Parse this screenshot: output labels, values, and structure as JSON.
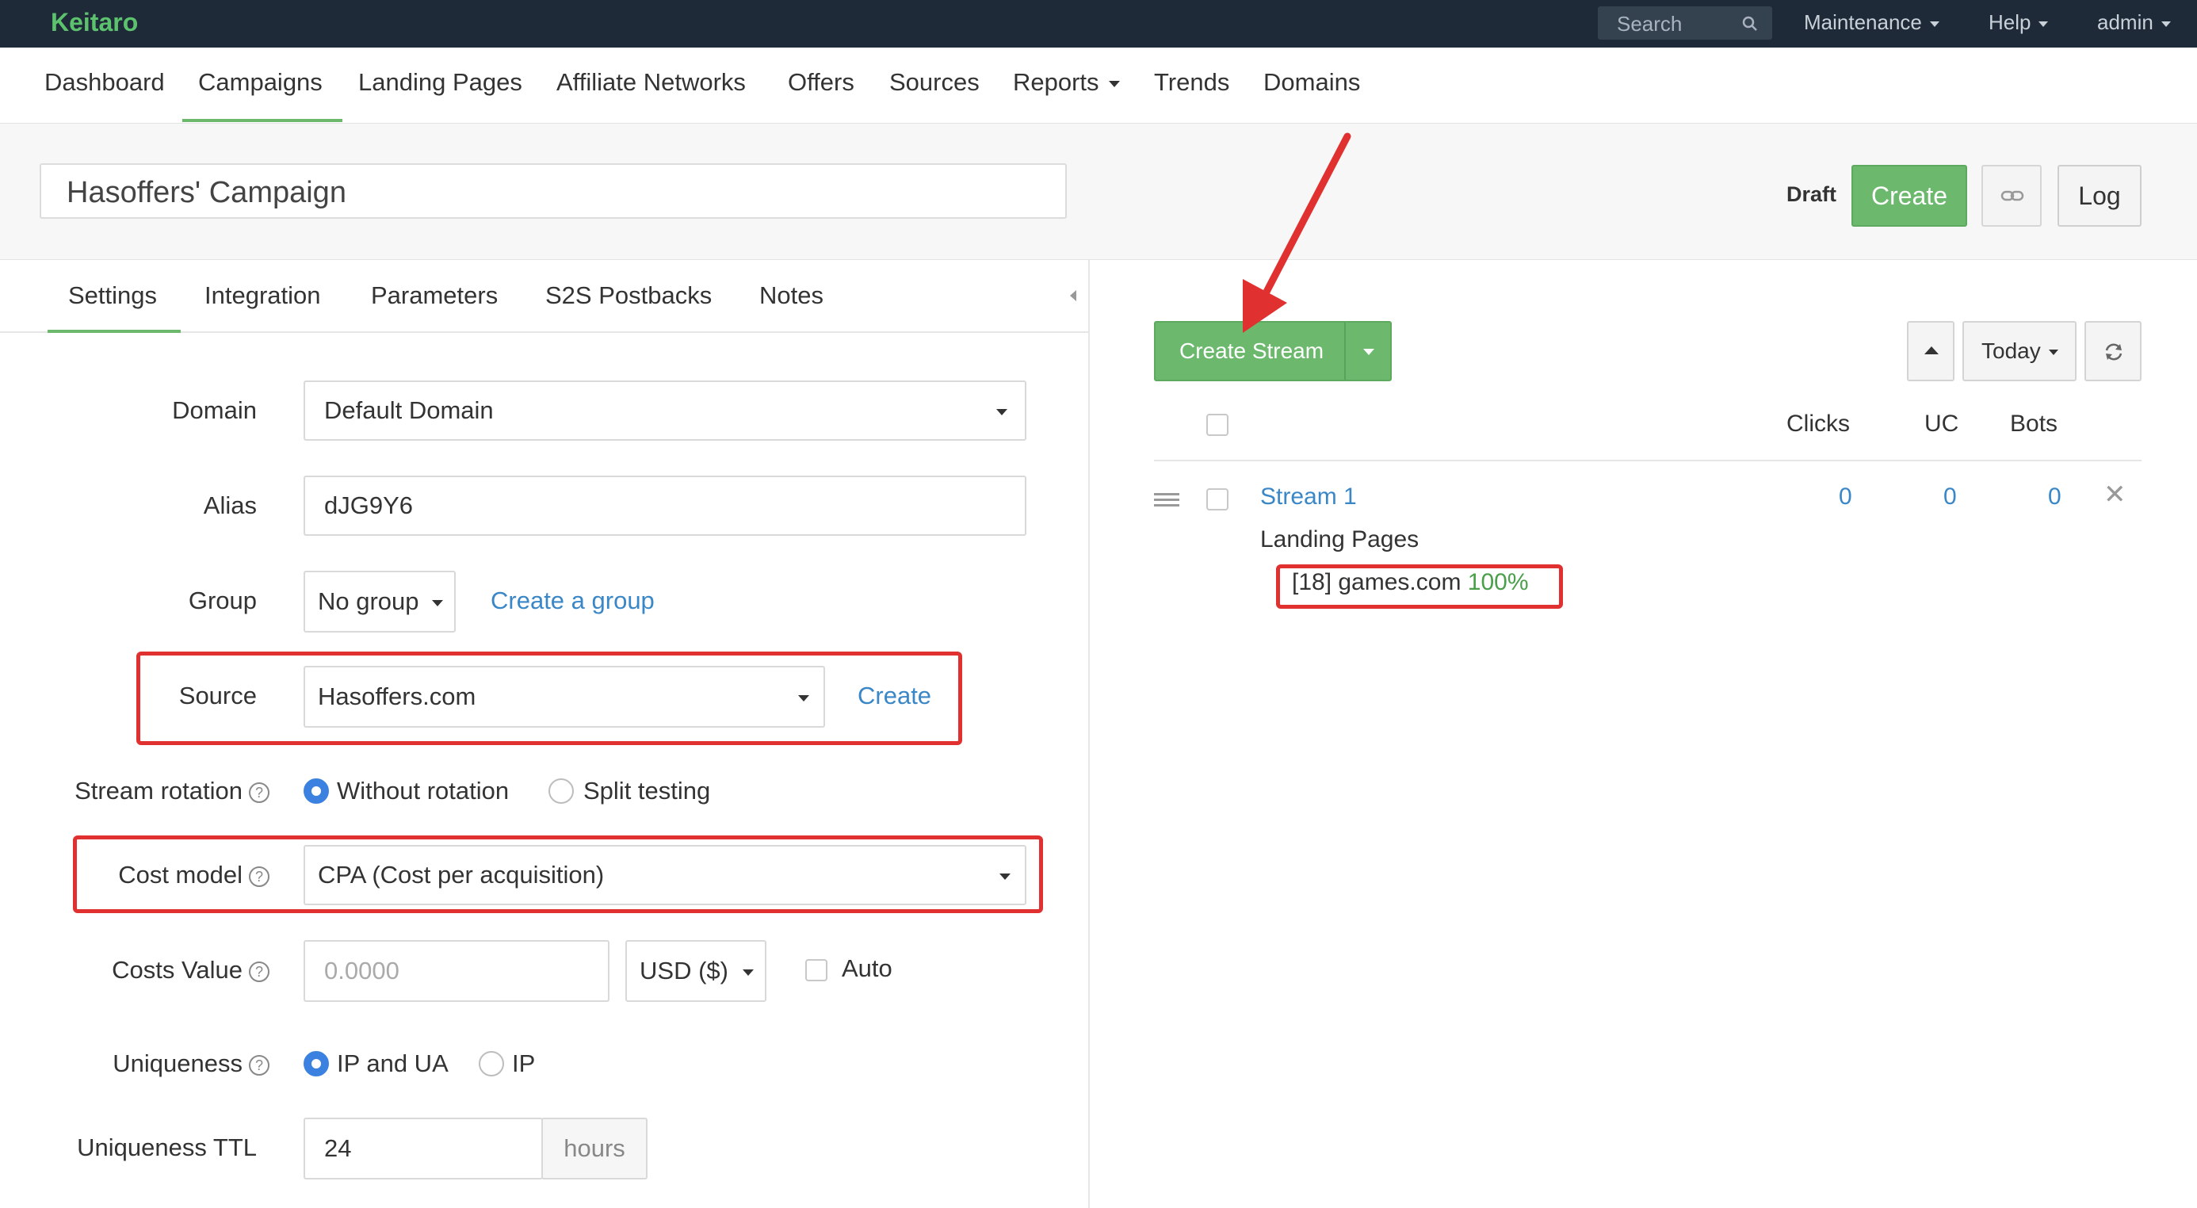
{
  "app": {
    "logo": "Keitaro"
  },
  "topbar": {
    "search_placeholder": "Search",
    "menus": [
      "Maintenance",
      "Help",
      "admin"
    ]
  },
  "mainnav": {
    "items": [
      "Dashboard",
      "Campaigns",
      "Landing Pages",
      "Affiliate Networks",
      "Offers",
      "Sources",
      "Reports",
      "Trends",
      "Domains"
    ],
    "active": "Campaigns"
  },
  "campaign": {
    "name": "Hasoffers' Campaign",
    "status": "Draft",
    "create_label": "Create",
    "log_label": "Log"
  },
  "settings": {
    "tabs": [
      "Settings",
      "Integration",
      "Parameters",
      "S2S Postbacks",
      "Notes"
    ],
    "active_tab": "Settings",
    "domain": {
      "label": "Domain",
      "value": "Default Domain"
    },
    "alias": {
      "label": "Alias",
      "value": "dJG9Y6"
    },
    "group": {
      "label": "Group",
      "value": "No group",
      "link": "Create a group"
    },
    "source": {
      "label": "Source",
      "value": "Hasoffers.com",
      "link": "Create"
    },
    "stream_rotation": {
      "label": "Stream rotation",
      "options": [
        "Without rotation",
        "Split testing"
      ],
      "selected": "Without rotation"
    },
    "cost_model": {
      "label": "Cost model",
      "value": "CPA (Cost per acquisition)"
    },
    "costs_value": {
      "label": "Costs Value",
      "placeholder": "0.0000",
      "currency": "USD ($)",
      "auto_label": "Auto"
    },
    "uniqueness": {
      "label": "Uniqueness",
      "options": [
        "IP and UA",
        "IP"
      ],
      "selected": "IP and UA"
    },
    "uniqueness_ttl": {
      "label": "Uniqueness TTL",
      "value": "24",
      "unit": "hours"
    }
  },
  "streams": {
    "create_label": "Create Stream",
    "period": "Today",
    "columns": [
      "Clicks",
      "UC",
      "Bots"
    ],
    "rows": [
      {
        "name": "Stream 1",
        "clicks": "0",
        "uc": "0",
        "bots": "0",
        "section": "Landing Pages",
        "landing": "[18] games.com",
        "share": "100%"
      }
    ]
  },
  "colors": {
    "accent_green": "#6cb96e",
    "link_blue": "#3a87c8",
    "highlight_red": "#e03030",
    "topbar_bg": "#1f2a38"
  }
}
